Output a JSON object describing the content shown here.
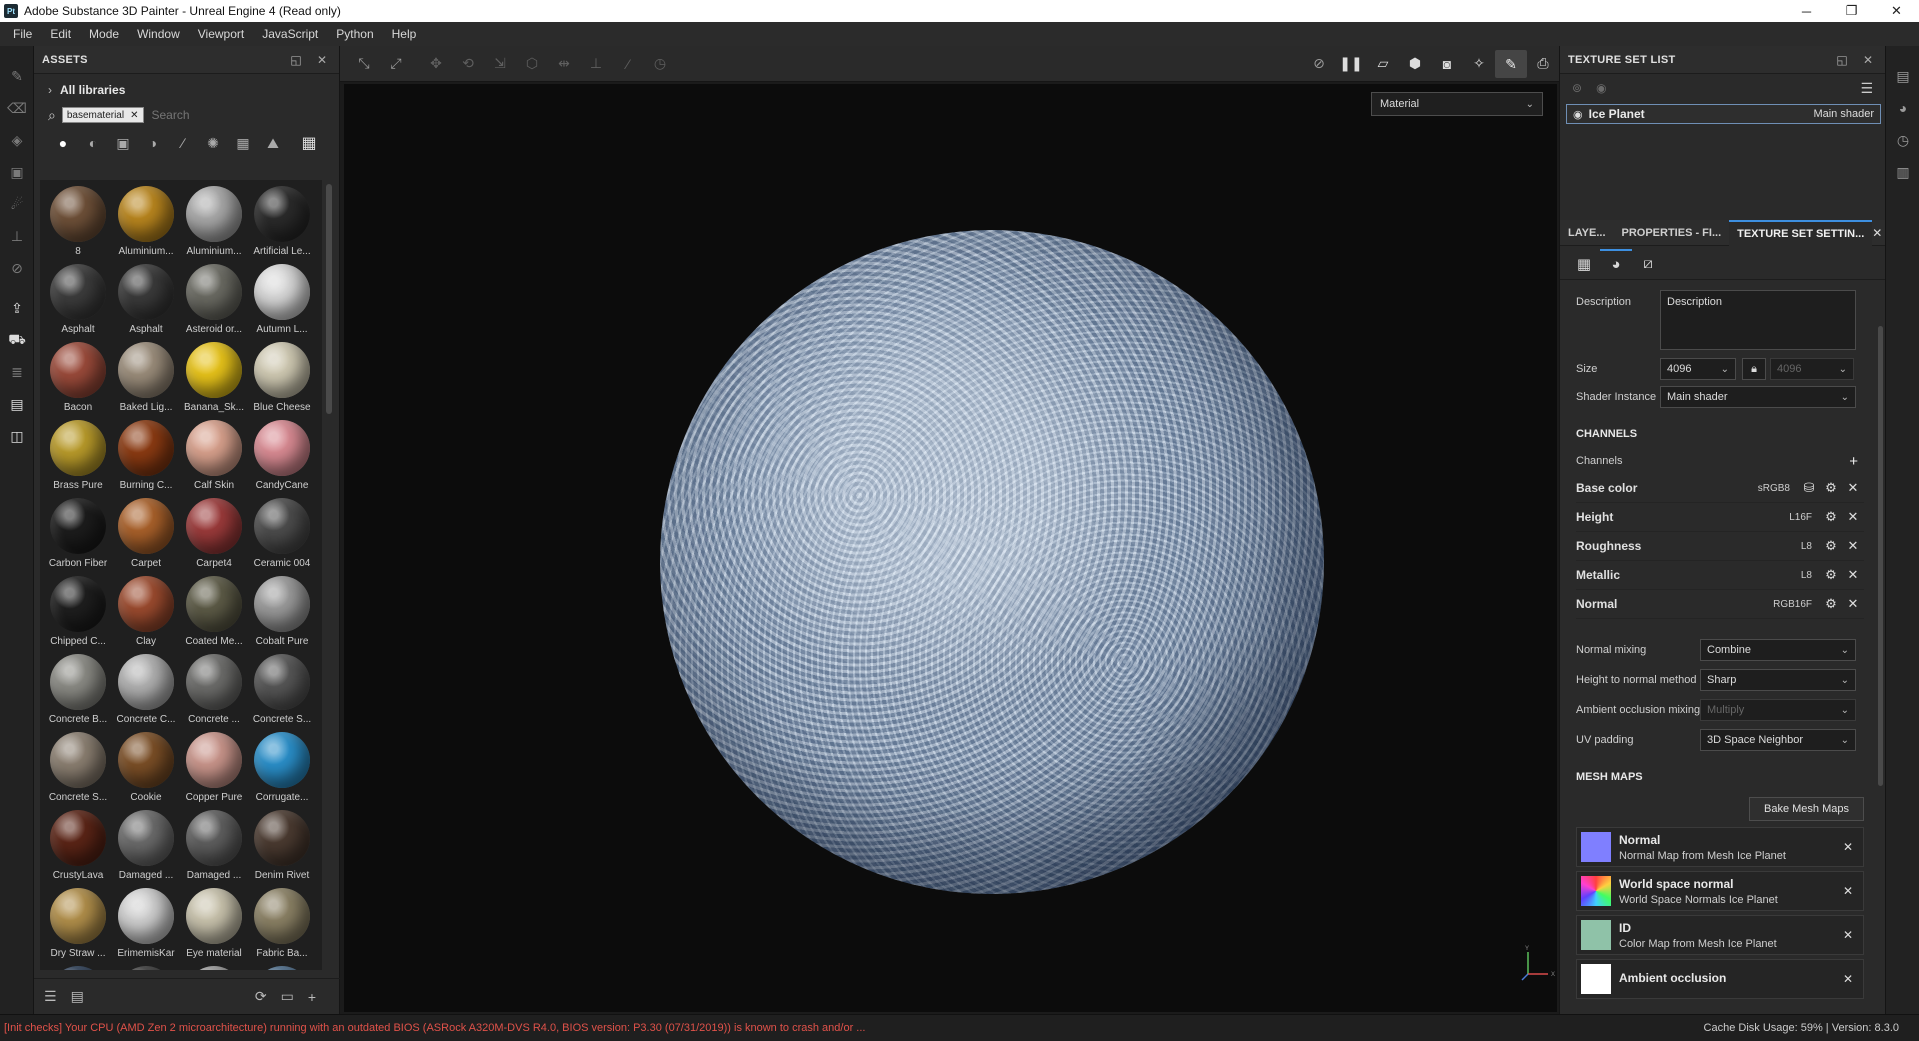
{
  "titlebar": {
    "app_icon": "Pt",
    "title": "Adobe Substance 3D Painter - Unreal Engine 4 (Read only)",
    "minimize": "─",
    "maximize": "❐",
    "close": "✕"
  },
  "menubar": {
    "items": [
      "File",
      "Edit",
      "Mode",
      "Window",
      "Viewport",
      "JavaScript",
      "Python",
      "Help"
    ]
  },
  "assets": {
    "title": "ASSETS",
    "libraries_label": "All libraries",
    "search_chip": "basematerial",
    "search_placeholder": "Search",
    "items": [
      {
        "label": "8",
        "color": "#6e5038"
      },
      {
        "label": "Aluminium...",
        "color": "#b8851e"
      },
      {
        "label": "Aluminium...",
        "color": "#a8a8a8"
      },
      {
        "label": "Artificial Le...",
        "color": "#2a2a2a"
      },
      {
        "label": "Asphalt",
        "color": "#3c3c3c"
      },
      {
        "label": "Asphalt",
        "color": "#3a3a3a"
      },
      {
        "label": "Asteroid or...",
        "color": "#6a6a62"
      },
      {
        "label": "Autumn L...",
        "color": "#d8d8d8"
      },
      {
        "label": "Bacon",
        "color": "#9a4a3a"
      },
      {
        "label": "Baked Lig...",
        "color": "#9a8c7a"
      },
      {
        "label": "Banana_Sk...",
        "color": "#e6c21a"
      },
      {
        "label": "Blue Cheese",
        "color": "#cfc9b2"
      },
      {
        "label": "Brass Pure",
        "color": "#b89a2a"
      },
      {
        "label": "Burning C...",
        "color": "#8a3a12"
      },
      {
        "label": "Calf Skin",
        "color": "#d7a08c"
      },
      {
        "label": "CandyCane",
        "color": "#d88a92"
      },
      {
        "label": "Carbon Fiber",
        "color": "#1c1c1c"
      },
      {
        "label": "Carpet",
        "color": "#a8602a"
      },
      {
        "label": "Carpet4",
        "color": "#9a3a3a"
      },
      {
        "label": "Ceramic 004",
        "color": "#4c4c4c"
      },
      {
        "label": "Chipped C...",
        "color": "#1e1e1e"
      },
      {
        "label": "Clay",
        "color": "#9a4a2e"
      },
      {
        "label": "Coated Me...",
        "color": "#5c5a46"
      },
      {
        "label": "Cobalt Pure",
        "color": "#9a9a9a"
      },
      {
        "label": "Concrete B...",
        "color": "#8a8a84"
      },
      {
        "label": "Concrete C...",
        "color": "#b0b0b0"
      },
      {
        "label": "Concrete ...",
        "color": "#6c6c6a"
      },
      {
        "label": "Concrete S...",
        "color": "#565656"
      },
      {
        "label": "Concrete S...",
        "color": "#8a7e70"
      },
      {
        "label": "Cookie",
        "color": "#7a4e26"
      },
      {
        "label": "Copper Pure",
        "color": "#c8948a"
      },
      {
        "label": "Corrugate...",
        "color": "#2a8ec8"
      },
      {
        "label": "CrustyLava",
        "color": "#5a2416"
      },
      {
        "label": "Damaged ...",
        "color": "#6a6a6a"
      },
      {
        "label": "Damaged ...",
        "color": "#5e5e5e"
      },
      {
        "label": "Denim Rivet",
        "color": "#4a3a30"
      },
      {
        "label": "Dry Straw ...",
        "color": "#b08e4a"
      },
      {
        "label": "ErimemisKar",
        "color": "#cfcfcf"
      },
      {
        "label": "Eye material",
        "color": "#c8c2ac"
      },
      {
        "label": "Fabric Ba...",
        "color": "#8a8064"
      },
      {
        "label": "",
        "color": "#2a3c54"
      },
      {
        "label": "",
        "color": "#3a3a3a"
      },
      {
        "label": "",
        "color": "#9a9a9a"
      },
      {
        "label": "",
        "color": "#4a6a88"
      }
    ]
  },
  "viewport": {
    "mode_value": "Material"
  },
  "texture_set_list": {
    "title": "TEXTURE SET LIST",
    "set_name": "Ice Planet",
    "shader": "Main shader"
  },
  "tabs": {
    "layers": "LAYE...",
    "properties": "PROPERTIES - FI...",
    "texture_set_settings": "TEXTURE SET SETTIN..."
  },
  "settings": {
    "description_label": "Description",
    "description_value": "Description",
    "size_label": "Size",
    "size_value": "4096",
    "size_linked_value": "4096",
    "shader_instance_label": "Shader Instance",
    "shader_instance_value": "Main shader",
    "channels_title": "CHANNELS",
    "channels_label": "Channels",
    "channels": [
      {
        "name": "Base color",
        "format": "sRGB8"
      },
      {
        "name": "Height",
        "format": "L16F"
      },
      {
        "name": "Roughness",
        "format": "L8"
      },
      {
        "name": "Metallic",
        "format": "L8"
      },
      {
        "name": "Normal",
        "format": "RGB16F"
      }
    ],
    "normal_mixing_label": "Normal mixing",
    "normal_mixing_value": "Combine",
    "height_to_normal_label": "Height to normal method",
    "height_to_normal_value": "Sharp",
    "ao_mixing_label": "Ambient occlusion mixing",
    "ao_mixing_value": "Multiply",
    "uv_padding_label": "UV padding",
    "uv_padding_value": "3D Space Neighbor",
    "mesh_maps_title": "MESH MAPS",
    "bake_button": "Bake Mesh Maps",
    "mesh_maps": [
      {
        "name": "Normal",
        "sub": "Normal Map from Mesh Ice Planet",
        "swatch": "#7f7fff"
      },
      {
        "name": "World space normal",
        "sub": "World Space Normals Ice Planet",
        "swatch": "rainbow"
      },
      {
        "name": "ID",
        "sub": "Color Map from Mesh Ice Planet",
        "swatch": "#8fc2a8"
      },
      {
        "name": "Ambient occlusion",
        "sub": "",
        "swatch": "#ffffff"
      }
    ]
  },
  "statusbar": {
    "warning": "[Init checks] Your CPU (AMD Zen 2 microarchitecture) running with an outdated BIOS (ASRock A320M-DVS R4.0, BIOS version: P3.30 (07/31/2019)) is known to crash and/or ...",
    "cache": "Cache Disk Usage:   59% | Version: 8.3.0"
  }
}
